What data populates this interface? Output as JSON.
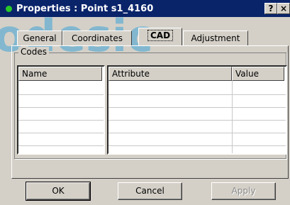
{
  "window": {
    "title": "Properties : Point s1_4160",
    "help_label": "?",
    "close_label": "×"
  },
  "tabs": [
    {
      "label": "General"
    },
    {
      "label": "Coordinates"
    },
    {
      "label": "CAD"
    },
    {
      "label": "Adjustment"
    }
  ],
  "codes": {
    "group_label": "Codes",
    "name_header": "Name",
    "attribute_header": "Attribute",
    "value_header": "Value"
  },
  "buttons": {
    "ok": "OK",
    "cancel": "Cancel",
    "apply": "Apply"
  },
  "watermark": {
    "text": "odesic"
  },
  "colors": {
    "titlebar": "#0a246a",
    "face": "#d4d0c8",
    "watermark": "#1e9ad6"
  }
}
